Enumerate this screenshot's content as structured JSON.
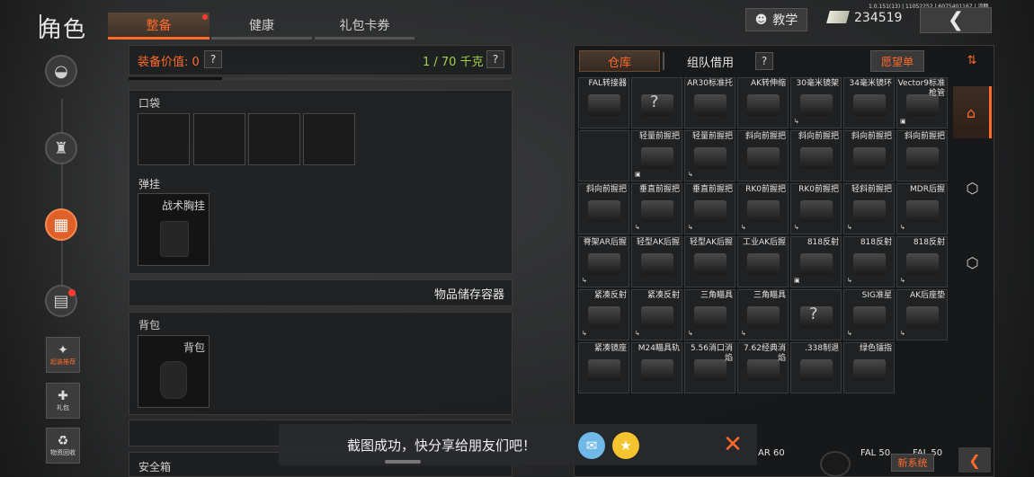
{
  "header": {
    "title": "角色",
    "tabs": [
      {
        "label": "整备",
        "active": true,
        "has_dot": true
      },
      {
        "label": "健康",
        "active": false
      },
      {
        "label": "礼包卡券",
        "active": false
      }
    ],
    "build_info": "1.0.151(13) | 11052252 | 6075401167 | 流畅",
    "tutorial_label": "教学",
    "money": "234519",
    "back_icon": "chevron-left-icon"
  },
  "left_nav": {
    "items": [
      {
        "name": "helmet-icon",
        "active": false
      },
      {
        "name": "armor-icon",
        "active": false
      },
      {
        "name": "chest-rig-icon",
        "active": true
      },
      {
        "name": "inventory-box-icon",
        "active": false,
        "has_dot": true
      }
    ],
    "buttons": [
      {
        "label": "起装推荐",
        "icon": "loadout-icon",
        "color": "#ff6a2b"
      },
      {
        "label": "礼包",
        "icon": "gift-icon"
      },
      {
        "label": "物资回收",
        "icon": "recycle-icon"
      }
    ]
  },
  "equipment": {
    "value_label": "装备价值: 0",
    "weight": "1 / 70 千克",
    "pockets_label": "口袋",
    "rig_section_label": "弹挂",
    "rig_slot_label": "战术胸挂",
    "container_label": "物品储存容器",
    "backpack_section_label": "背包",
    "backpack_slot_label": "背包",
    "safe_label": "安全箱"
  },
  "storage": {
    "tab_warehouse": "仓库",
    "tab_team": "组队借用",
    "wish_label": "愿望单",
    "items": [
      {
        "name": "FAL转接器",
        "mark": ""
      },
      {
        "name": "",
        "mark": "",
        "unknown": true
      },
      {
        "name": "AR30标准托",
        "mark": ""
      },
      {
        "name": "AK转伸缩",
        "mark": ""
      },
      {
        "name": "30毫米镜架",
        "mark": "↳"
      },
      {
        "name": "34毫米镜环",
        "mark": ""
      },
      {
        "name": "Vector9标准枪管",
        "mark": "▣"
      },
      {
        "name": "",
        "mark": ""
      },
      {
        "name": "轻量前握把",
        "mark": "▣"
      },
      {
        "name": "轻量前握把",
        "mark": "↳"
      },
      {
        "name": "斜向前握把",
        "mark": ""
      },
      {
        "name": "斜向前握把",
        "mark": ""
      },
      {
        "name": "斜向前握把",
        "mark": ""
      },
      {
        "name": "斜向前握把",
        "mark": ""
      },
      {
        "name": "斜向前握把",
        "mark": ""
      },
      {
        "name": "垂直前握把",
        "mark": "↳"
      },
      {
        "name": "垂直前握把",
        "mark": "↳"
      },
      {
        "name": "RK0前握把",
        "mark": "↳"
      },
      {
        "name": "RK0前握把",
        "mark": "↳"
      },
      {
        "name": "轻斜前握把",
        "mark": "↳"
      },
      {
        "name": "MDR后握",
        "mark": "↳"
      },
      {
        "name": "脊架AR后握",
        "mark": "↳"
      },
      {
        "name": "轻型AK后握",
        "mark": ""
      },
      {
        "name": "轻型AK后握",
        "mark": ""
      },
      {
        "name": "工业AK后握",
        "mark": ""
      },
      {
        "name": "818反射",
        "mark": "▣"
      },
      {
        "name": "818反射",
        "mark": "↳"
      },
      {
        "name": "818反射",
        "mark": "↳"
      },
      {
        "name": "紧凑反射",
        "mark": "↳"
      },
      {
        "name": "紧凑反射",
        "mark": "↳"
      },
      {
        "name": "三角瞄具",
        "mark": "↳"
      },
      {
        "name": "三角瞄具",
        "mark": "↳"
      },
      {
        "name": "",
        "mark": "",
        "unknown": true
      },
      {
        "name": "SIG准星",
        "mark": "↳"
      },
      {
        "name": "AK后座垫",
        "mark": "↳"
      },
      {
        "name": "紧凑镜座",
        "mark": ""
      },
      {
        "name": "M24瞄具轨",
        "mark": ""
      },
      {
        "name": "5.56消口消焰",
        "mark": ""
      },
      {
        "name": "7.62经典消焰",
        "mark": ""
      },
      {
        "name": ".338制退",
        "mark": ""
      },
      {
        "name": "绿色镭指",
        "mark": ""
      }
    ],
    "bottom_labels": [
      "AR 60",
      "FAL 50",
      "FAL 50"
    ],
    "new_system_label": "新系统"
  },
  "toast": {
    "text": "截图成功，快分享给朋友们吧！",
    "share_icons": [
      "qq-icon",
      "qzone-icon"
    ]
  },
  "right_nav": [
    "home-icon",
    "cube-icon",
    "cube-icon"
  ],
  "colors": {
    "accent": "#ff6a2b",
    "weight_green": "#9fd34a"
  }
}
